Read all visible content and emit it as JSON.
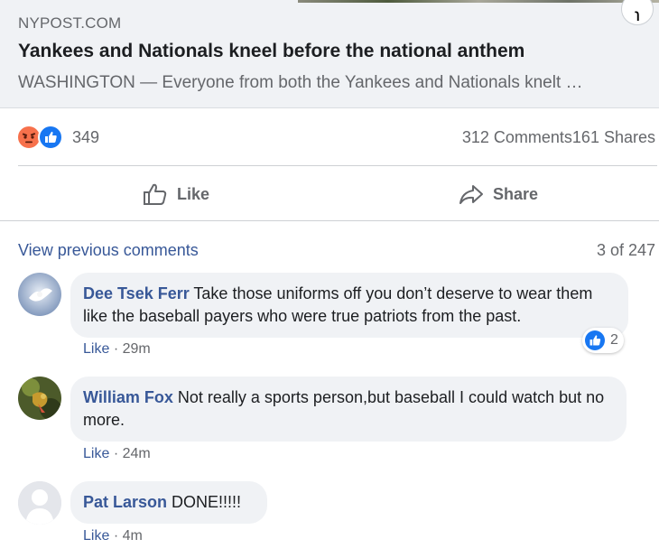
{
  "link_preview": {
    "domain": "NYPOST.COM",
    "title": "Yankees and Nationals kneel before the national anthem",
    "description": "WASHINGTON — Everyone from both the Yankees and Nationals knelt …",
    "corner_badge": "ɿ"
  },
  "stats": {
    "reactions": [
      "angry-icon",
      "like-icon"
    ],
    "reaction_count": "349",
    "comments": "312 Comments",
    "shares": "161 Shares"
  },
  "actions": {
    "like_label": "Like",
    "share_label": "Share"
  },
  "comments_header": {
    "view_previous": "View previous comments",
    "page_count": "3 of 247"
  },
  "comments": [
    {
      "author": "Dee Tsek Ferr",
      "text": "Take those uniforms off you don’t deserve to wear them like the baseball payers who were true patriots from the past.",
      "like_label": "Like",
      "separator": "·",
      "time": "29m",
      "reaction_count": "2"
    },
    {
      "author": "William Fox",
      "text": "Not really a sports person,but baseball I could watch but no more.",
      "like_label": "Like",
      "separator": "·",
      "time": "24m"
    },
    {
      "author": "Pat Larson",
      "text": "DONE!!!!!",
      "like_label": "Like",
      "separator": "·",
      "time": "4m"
    }
  ],
  "colors": {
    "link_blue": "#385898",
    "bubble_bg": "#f0f2f5",
    "secondary_text": "#65676b",
    "like_blue": "#1877f2",
    "angry_orange": "#f7714c"
  }
}
